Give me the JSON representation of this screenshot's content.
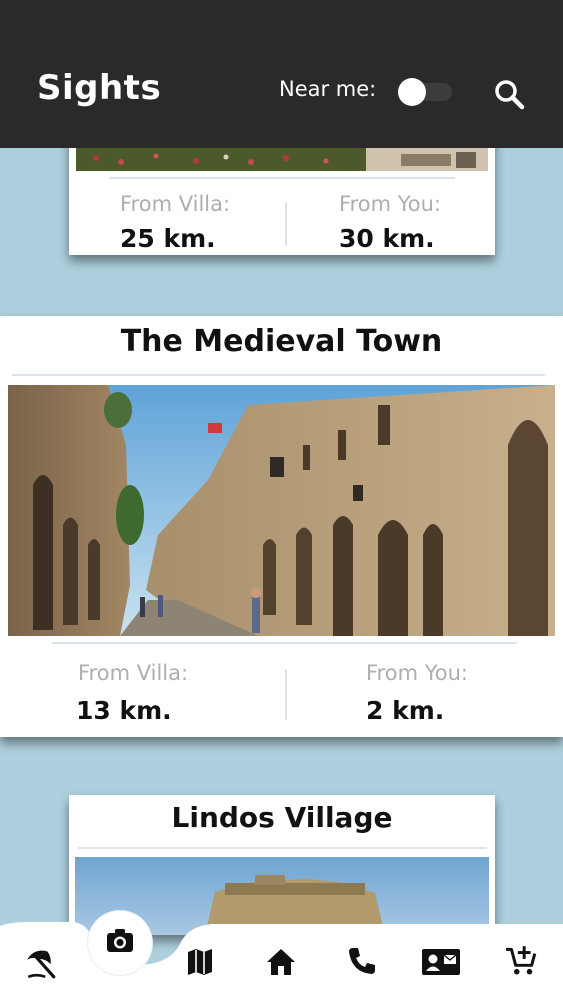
{
  "header": {
    "title": "Sights",
    "near_me_label": "Near me:",
    "near_me_toggle": "off",
    "search_icon": "search-icon"
  },
  "cards": [
    {
      "title": "",
      "from_villa_label": "From Villa:",
      "from_villa_value": "25 km.",
      "from_you_label": "From You:",
      "from_you_value": "30 km."
    },
    {
      "title": "The Medieval Town",
      "from_villa_label": "From Villa:",
      "from_villa_value": "13 km.",
      "from_you_label": "From You:",
      "from_you_value": "2 km."
    },
    {
      "title": "Lindos Village"
    }
  ],
  "bottom_nav": [
    {
      "icon": "beach-umbrella-icon"
    },
    {
      "icon": "camera-icon",
      "active": true
    },
    {
      "icon": "map-icon"
    },
    {
      "icon": "home-icon"
    },
    {
      "icon": "phone-icon"
    },
    {
      "icon": "contact-card-icon"
    },
    {
      "icon": "cart-add-icon"
    }
  ],
  "colors": {
    "header": "#2b292a",
    "background": "#aecfdd",
    "card": "#ffffff",
    "label": "#b0adab",
    "value": "#111111"
  }
}
